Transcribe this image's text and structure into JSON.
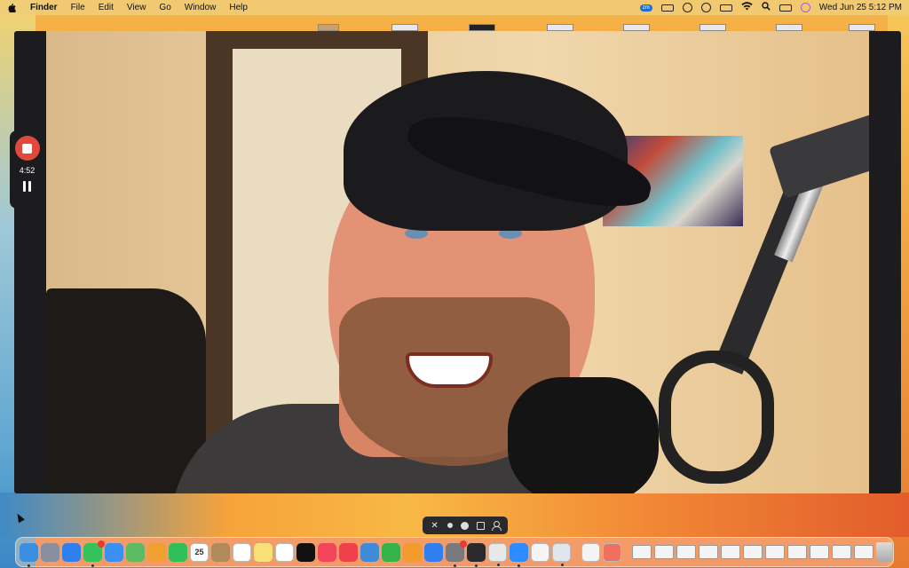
{
  "menubar": {
    "app_name": "Finder",
    "menus": [
      "File",
      "Edit",
      "View",
      "Go",
      "Window",
      "Help"
    ],
    "zoom_badge": "zm",
    "datetime": "Wed Jun 25  5:12 PM"
  },
  "recording": {
    "elapsed": "4:52"
  },
  "camera_toolbar": {
    "close_glyph": "✕"
  },
  "dock": {
    "apps": [
      {
        "name": "finder-icon",
        "color": "#3b8fe0",
        "running": true
      },
      {
        "name": "launchpad-icon",
        "color": "#8a8fa0",
        "running": false
      },
      {
        "name": "safari-icon",
        "color": "#2f7ff0",
        "running": false
      },
      {
        "name": "messages-icon",
        "color": "#36c15b",
        "running": true,
        "badge": true
      },
      {
        "name": "mail-icon",
        "color": "#3a8ff5",
        "running": false
      },
      {
        "name": "maps-icon",
        "color": "#5dbb63",
        "running": false
      },
      {
        "name": "photos-icon",
        "color": "#f0a030",
        "running": false
      },
      {
        "name": "facetime-icon",
        "color": "#2fc05a",
        "running": false
      },
      {
        "name": "calendar-icon",
        "color": "#ffffff",
        "running": false,
        "label": "25"
      },
      {
        "name": "contacts-icon",
        "color": "#b08a5a",
        "running": false
      },
      {
        "name": "reminders-icon",
        "color": "#ffffff",
        "running": false
      },
      {
        "name": "notes-icon",
        "color": "#f7e07a",
        "running": false
      },
      {
        "name": "freeform-icon",
        "color": "#ffffff",
        "running": false
      },
      {
        "name": "tv-icon",
        "color": "#111111",
        "running": false
      },
      {
        "name": "music-icon",
        "color": "#f2455a",
        "running": false
      },
      {
        "name": "news-icon",
        "color": "#f0404a",
        "running": false
      },
      {
        "name": "keynote-icon",
        "color": "#3f8bd8",
        "running": false
      },
      {
        "name": "numbers-icon",
        "color": "#35b34a",
        "running": false
      },
      {
        "name": "pages-icon",
        "color": "#f29b2c",
        "running": false
      },
      {
        "name": "app-store-icon",
        "color": "#2f7ff0",
        "running": false
      },
      {
        "name": "system-settings-icon",
        "color": "#7a7a7e",
        "running": true,
        "badge": true
      },
      {
        "name": "final-cut-icon",
        "color": "#2a2a2e",
        "running": true
      },
      {
        "name": "chrome-icon",
        "color": "#e8e8e8",
        "running": true
      },
      {
        "name": "zoom-icon",
        "color": "#2d8cff",
        "running": true
      },
      {
        "name": "pencil-icon",
        "color": "#f5f5f5",
        "running": false
      },
      {
        "name": "screen-recorder-icon",
        "color": "#dfe6ee",
        "running": true
      }
    ],
    "recents": [
      {
        "name": "document-icon",
        "color": "#f4f4f4"
      },
      {
        "name": "help-icon",
        "color": "#f07060"
      }
    ],
    "files_count_label": "",
    "trash_label": ""
  }
}
